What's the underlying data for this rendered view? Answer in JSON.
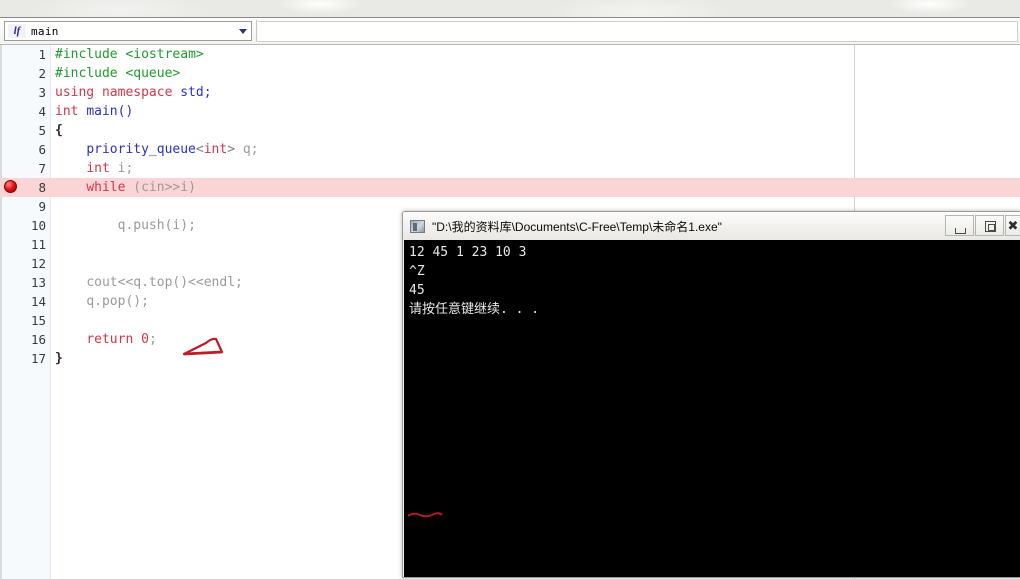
{
  "window": {
    "toolbar": {
      "function_selector_value": "main",
      "function_icon": "function-icon",
      "dropdown_icon": "chevron-down-icon"
    }
  },
  "editor": {
    "breakpoint_line": 8,
    "highlighted_line": 8,
    "annotation_color": "#c11a26",
    "lines": [
      {
        "n": "1",
        "tokens": [
          {
            "t": "#include ",
            "c": "t-pre"
          },
          {
            "t": "<iostream>",
            "c": "t-pre"
          }
        ]
      },
      {
        "n": "2",
        "tokens": [
          {
            "t": "#include ",
            "c": "t-pre"
          },
          {
            "t": "<queue>",
            "c": "t-pre"
          }
        ]
      },
      {
        "n": "3",
        "tokens": [
          {
            "t": "using namespace ",
            "c": "t-kw"
          },
          {
            "t": "std;",
            "c": "t-type"
          }
        ]
      },
      {
        "n": "4",
        "tokens": [
          {
            "t": "int ",
            "c": "t-kw"
          },
          {
            "t": "main()",
            "c": "t-type"
          }
        ]
      },
      {
        "n": "5",
        "tokens": [
          {
            "t": "{",
            "c": "t-brace"
          }
        ]
      },
      {
        "n": "6",
        "tokens": [
          {
            "t": "    ",
            "c": "t-plain"
          },
          {
            "t": "priority_queue",
            "c": "t-type"
          },
          {
            "t": "<",
            "c": "t-punct"
          },
          {
            "t": "int",
            "c": "t-kw"
          },
          {
            "t": "> ",
            "c": "t-punct"
          },
          {
            "t": "q;",
            "c": "t-plain"
          }
        ]
      },
      {
        "n": "7",
        "tokens": [
          {
            "t": "    ",
            "c": "t-plain"
          },
          {
            "t": "int ",
            "c": "t-kw"
          },
          {
            "t": "i;",
            "c": "t-plain"
          }
        ]
      },
      {
        "n": "8",
        "tokens": [
          {
            "t": "    ",
            "c": "t-plain"
          },
          {
            "t": "while ",
            "c": "t-kw"
          },
          {
            "t": "(cin>>i)",
            "c": "t-plain"
          }
        ]
      },
      {
        "n": "9",
        "tokens": []
      },
      {
        "n": "10",
        "tokens": [
          {
            "t": "        ",
            "c": "t-plain"
          },
          {
            "t": "q.push(i);",
            "c": "t-plain"
          }
        ]
      },
      {
        "n": "11",
        "tokens": []
      },
      {
        "n": "12",
        "tokens": []
      },
      {
        "n": "13",
        "tokens": [
          {
            "t": "    ",
            "c": "t-plain"
          },
          {
            "t": "cout<<q.top()<<endl;",
            "c": "t-plain"
          }
        ]
      },
      {
        "n": "14",
        "tokens": [
          {
            "t": "    ",
            "c": "t-plain"
          },
          {
            "t": "q.pop();",
            "c": "t-plain"
          }
        ]
      },
      {
        "n": "15",
        "tokens": []
      },
      {
        "n": "16",
        "tokens": [
          {
            "t": "    ",
            "c": "t-plain"
          },
          {
            "t": "return ",
            "c": "t-kw"
          },
          {
            "t": "0",
            "c": "t-num"
          },
          {
            "t": ";",
            "c": "t-plain"
          }
        ]
      },
      {
        "n": "17",
        "tokens": [
          {
            "t": "}",
            "c": "t-brace"
          }
        ]
      }
    ]
  },
  "console": {
    "title": "\"D:\\我的资料库\\Documents\\C-Free\\Temp\\未命名1.exe\"",
    "icon": "console-app-icon",
    "buttons": {
      "minimize": "minimize-icon",
      "maximize": "restore-icon",
      "close": "close-icon",
      "close_glyph": "✖"
    },
    "output_lines": [
      "12 45 1 23 10 3",
      "^Z",
      "45",
      "请按任意键继续. . ."
    ]
  }
}
